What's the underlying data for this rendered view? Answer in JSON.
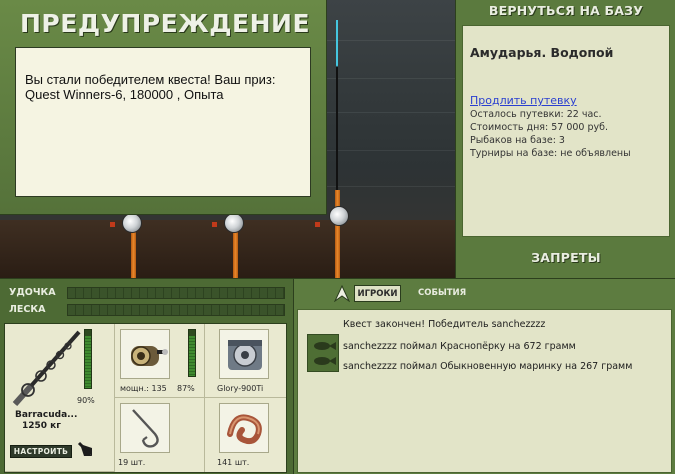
{
  "warning": {
    "title": "ПРЕДУПРЕЖДЕНИЕ",
    "message": "Вы стали победителем квеста! Ваш приз: Quest Winners-6, 180000 , Опыта"
  },
  "base": {
    "return_label": "ВЕРНУТЬСЯ НА БАЗУ",
    "name": "Амударья. Водопой",
    "extend_link": "Продлить путевку",
    "permit_left": "Осталось путевки: 22 час.",
    "day_cost": "Стоимость дня: 57 000 руб.",
    "anglers": "Рыбаков на базе: 3",
    "tournaments": "Турниры на базе: не объявлены",
    "bans_label": "ЗАПРЕТЫ"
  },
  "meters": {
    "rod_label": "УДОЧКА",
    "line_label": "ЛЕСКА",
    "rod_level": 0,
    "line_level": 0
  },
  "tackle": {
    "rod": {
      "name": "Barracuda...",
      "weight": "1250 кг",
      "durability": "90%",
      "durability_value": 0.9
    },
    "reel": {
      "power": "мощн.: 135",
      "durability": "87%",
      "durability_value": 0.87
    },
    "line": {
      "name": "Glory-900Ti"
    },
    "hook": {
      "count": "19 шт."
    },
    "bait": {
      "count": "141 шт."
    },
    "setup_button": "НАСТРОИТЬ"
  },
  "events": {
    "tab_players": "ИГРОКИ",
    "tab_events": "СОБЫТИЯ",
    "lines": [
      "Квест закончен! Победитель sanchezzzz",
      "sanchezzzz поймал Краснопёрку на 672 грамм",
      "sanchezzzz поймал Обыкновенную маринку на 267 грамм"
    ]
  },
  "colors": {
    "panel_green": "#5b7a3e",
    "paper": "#e2e4c8",
    "link_blue": "#2a3fd0",
    "rod_orange": "#e9892b"
  }
}
